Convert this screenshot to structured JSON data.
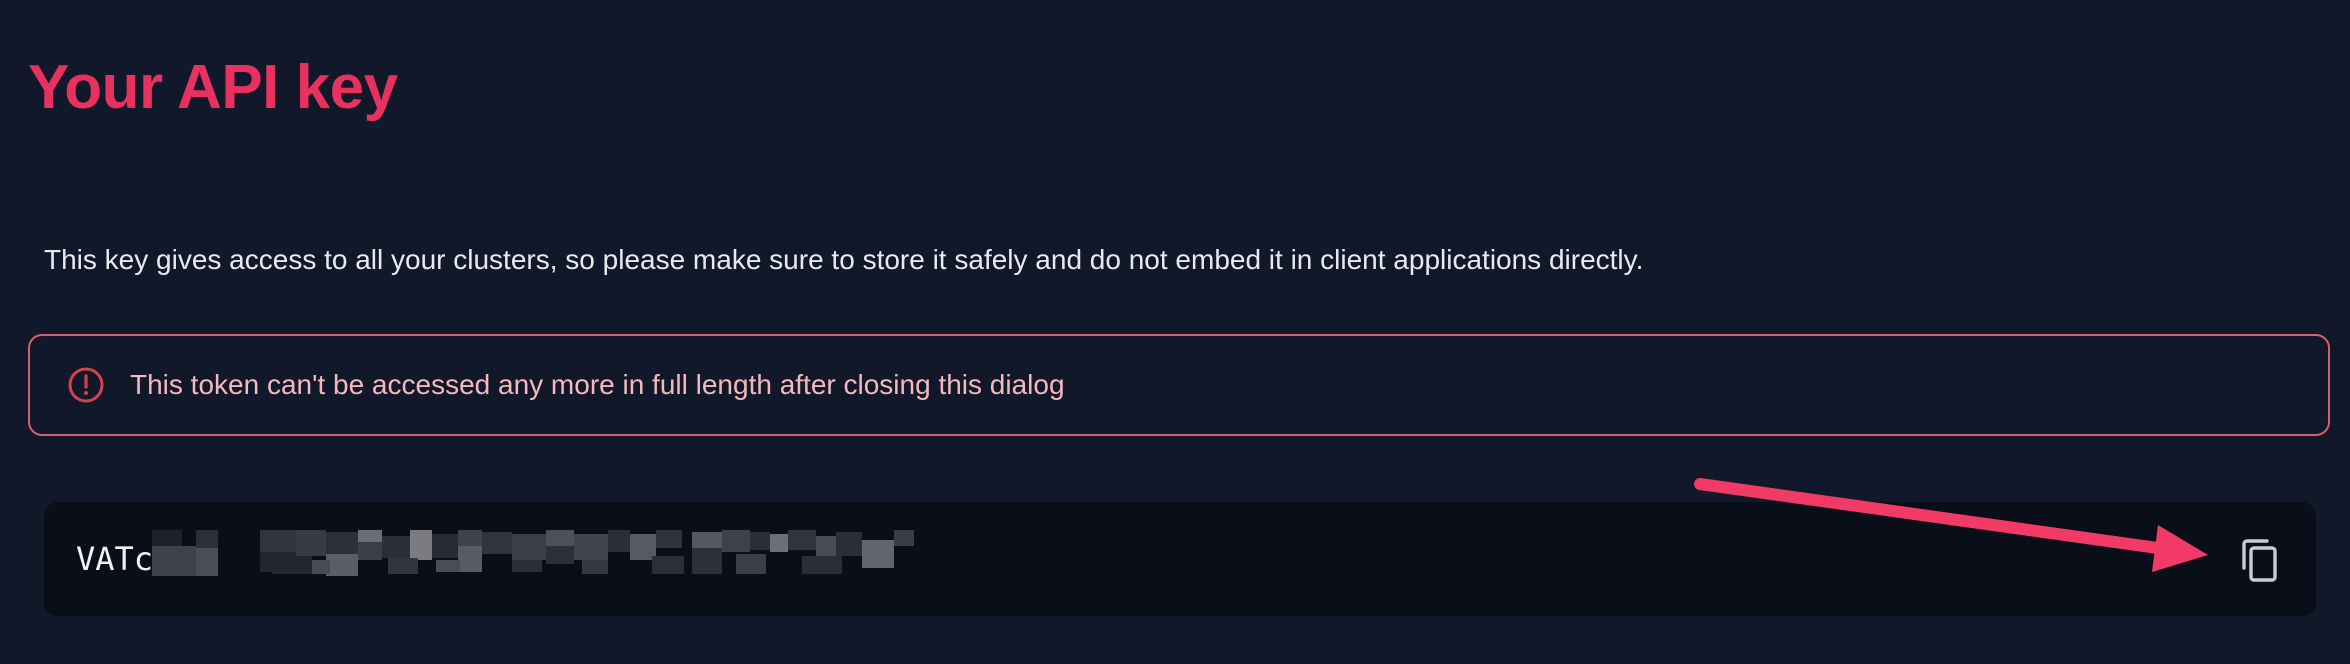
{
  "dialog": {
    "title": "Your API key",
    "description": "This key gives access to all your clusters, so please make sure to store it safely and do not embed it in client applications directly.",
    "warning": {
      "icon": "exclamation-circle-icon",
      "text": "This token can't be accessed any more in full length after closing this dialog"
    },
    "api_key": {
      "visible_prefix": "VATc",
      "redacted": true,
      "copy_icon": "copy-icon"
    }
  },
  "annotation": {
    "icon": "pointer-arrow",
    "color": "#f23a66"
  },
  "colors": {
    "background": "#111829",
    "title": "#e8315f",
    "warning_border": "#d7606c",
    "warning_text": "#f3b9be",
    "key_box": "#0a0e18"
  }
}
